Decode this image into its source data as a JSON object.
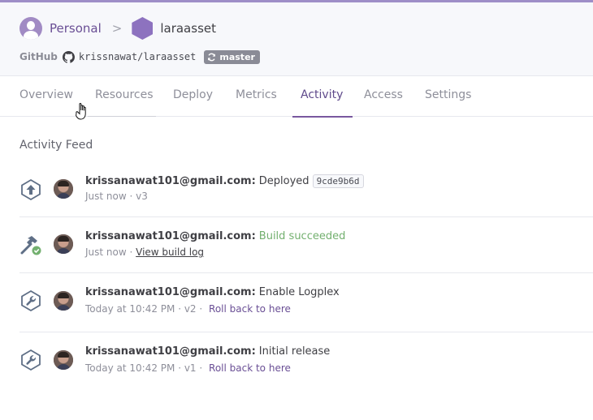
{
  "header": {
    "personal_label": "Personal",
    "breadcrumb_separator": ">",
    "app_name": "laraasset",
    "repo": {
      "provider": "GitHub",
      "name": "krissnawat/laraasset",
      "branch": "master"
    }
  },
  "tabs": [
    {
      "label": "Overview"
    },
    {
      "label": "Resources"
    },
    {
      "label": "Deploy"
    },
    {
      "label": "Metrics"
    },
    {
      "label": "Activity",
      "active": true
    },
    {
      "label": "Access"
    },
    {
      "label": "Settings"
    }
  ],
  "feed": {
    "title": "Activity Feed",
    "items": [
      {
        "icon": "deploy-icon",
        "user": "krissanawat101@gmail.com:",
        "message": "Deployed",
        "commit": "9cde9b6d",
        "meta": "Just now · v3"
      },
      {
        "icon": "build-icon",
        "user": "krissanawat101@gmail.com:",
        "message": "Build succeeded",
        "meta_prefix": "Just now ·",
        "meta_link": "View build log"
      },
      {
        "icon": "wrench-icon",
        "user": "krissanawat101@gmail.com:",
        "message": "Enable Logplex",
        "meta": "Today at 10:42 PM · v2 ·",
        "action": "Roll back to here"
      },
      {
        "icon": "wrench-icon",
        "user": "krissanawat101@gmail.com:",
        "message": "Initial release",
        "meta": "Today at 10:42 PM · v1 ·",
        "action": "Roll back to here"
      }
    ]
  },
  "colors": {
    "accent": "#79589f",
    "success": "#73b06f",
    "muted": "#8e8f9a",
    "header_bg": "#f7f8fb"
  }
}
